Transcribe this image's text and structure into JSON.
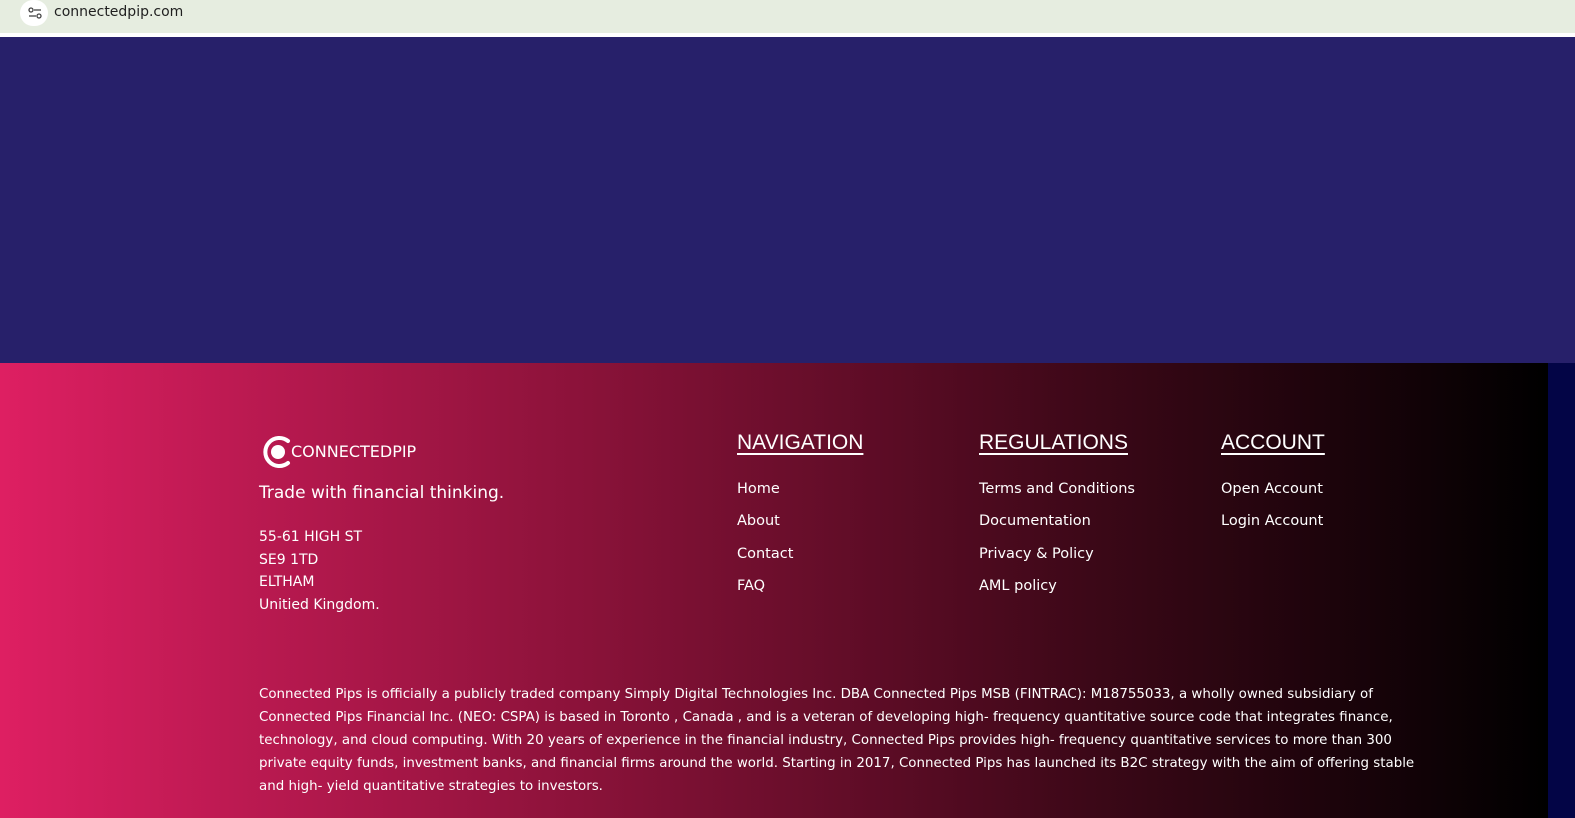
{
  "browser": {
    "url": "connectedpip.com"
  },
  "colors": {
    "hero_bg": "#27206a",
    "footer_gradient_start": "#de1f62",
    "footer_gradient_end": "#000000",
    "right_strip": "#030546",
    "address_bar_bg": "#e6ede0"
  },
  "footer": {
    "logo_text": "CONNECTEDPIP",
    "tagline": "Trade with financial thinking.",
    "address": [
      "55-61 HIGH ST",
      "SE9 1TD",
      "ELTHAM",
      "Unitied Kingdom."
    ],
    "navigation": {
      "title": "NAVIGATION",
      "links": [
        "Home",
        "About",
        "Contact",
        "FAQ"
      ]
    },
    "regulations": {
      "title": "REGULATIONS",
      "links": [
        "Terms and Conditions",
        "Documentation",
        "Privacy & Policy",
        "AML policy"
      ]
    },
    "account": {
      "title": "ACCOUNT",
      "links": [
        "Open Account",
        "Login Account"
      ]
    },
    "disclaimer": "Connected Pips is officially a publicly traded company Simply Digital Technologies Inc. DBA Connected Pips MSB (FINTRAC): M18755033, a wholly owned subsidiary of Connected Pips Financial Inc. (NEO: CSPA) is based in Toronto , Canada , and is a veteran of developing high- frequency quantitative source code that integrates finance, technology, and cloud computing. With 20 years of experience in the financial industry, Connected Pips provides high- frequency quantitative services to more than 300 private equity funds, investment banks, and financial firms around the world. Starting in 2017, Connected Pips has launched its B2C strategy with the aim of offering stable and high- yield quantitative strategies to investors."
  }
}
